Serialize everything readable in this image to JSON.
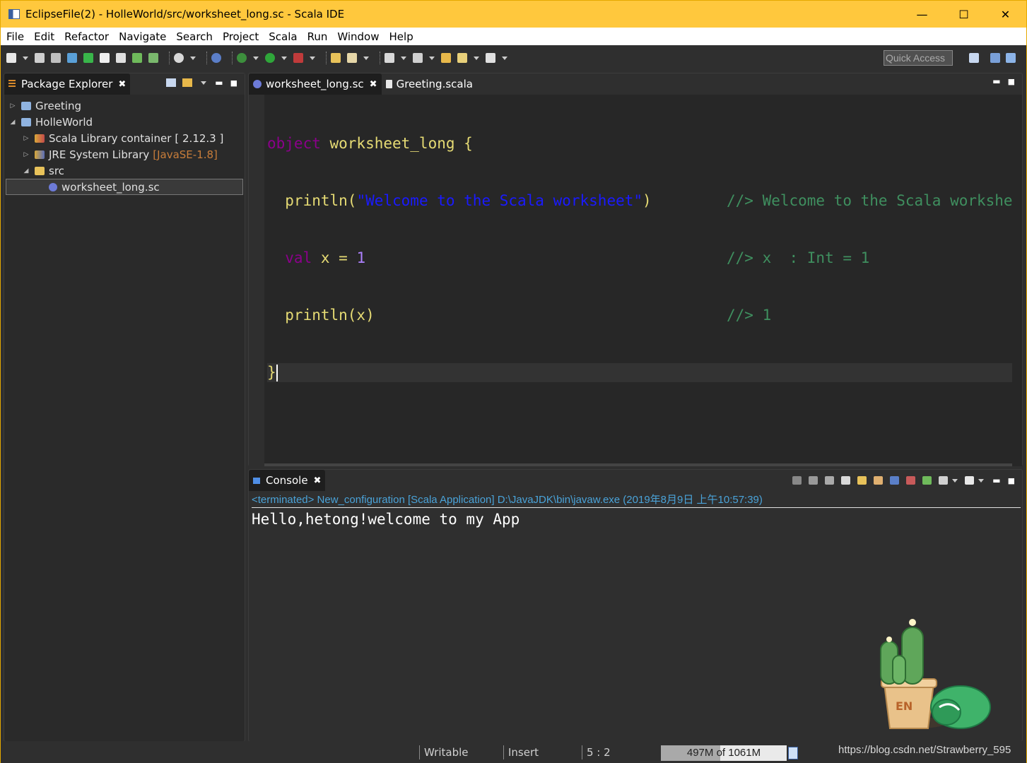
{
  "window": {
    "title": "EclipseFile(2) - HolleWorld/src/worksheet_long.sc - Scala IDE",
    "controls": {
      "minimize": "—",
      "maximize": "☐",
      "close": "✕"
    }
  },
  "menubar": {
    "items": [
      "File",
      "Edit",
      "Refactor",
      "Navigate",
      "Search",
      "Project",
      "Scala",
      "Run",
      "Window",
      "Help"
    ]
  },
  "toolbar": {
    "quick_access_placeholder": "Quick Access"
  },
  "package_explorer": {
    "tab_label": "Package Explorer",
    "tree": [
      {
        "label": "Greeting",
        "expanded": false
      },
      {
        "label": "HolleWorld",
        "expanded": true
      },
      {
        "label": "Scala Library container",
        "extra": "[ 2.12.3 ]"
      },
      {
        "label": "JRE System Library",
        "extra": "[JavaSE-1.8]"
      },
      {
        "label": "src",
        "expanded": true
      },
      {
        "label": "worksheet_long.sc",
        "selected": true
      }
    ]
  },
  "editor": {
    "tabs": [
      {
        "label": "worksheet_long.sc",
        "active": true
      },
      {
        "label": "Greeting.scala",
        "active": false
      }
    ],
    "code": {
      "l1_kw": "object",
      "l1_name": " worksheet_long {",
      "l2_fn": "  println(",
      "l2_str": "\"Welcome to the Scala worksheet\"",
      "l2_close": ")",
      "l2_cmt": "//> Welcome to the Scala workshe",
      "l3_kw": "  val",
      "l3_rest": " x = ",
      "l3_num": "1",
      "l3_cmt": "//> x  : Int = 1",
      "l4_code": "  println(x)",
      "l4_cmt": "//> 1",
      "l5_code": "}"
    }
  },
  "console": {
    "tab_label": "Console",
    "status": "<terminated> New_configuration [Scala Application] D:\\JavaJDK\\bin\\javaw.exe (2019年8月9日 上午10:57:39)",
    "output": "Hello,hetong!welcome to my App"
  },
  "statusbar": {
    "writable": "Writable",
    "insert": "Insert",
    "position": "5 : 2",
    "heap": "497M of 1061M",
    "heap_used_fraction": 0.47,
    "watermark": "https://blog.csdn.net/Strawberry_595"
  },
  "decoration": {
    "badge": "EN"
  }
}
